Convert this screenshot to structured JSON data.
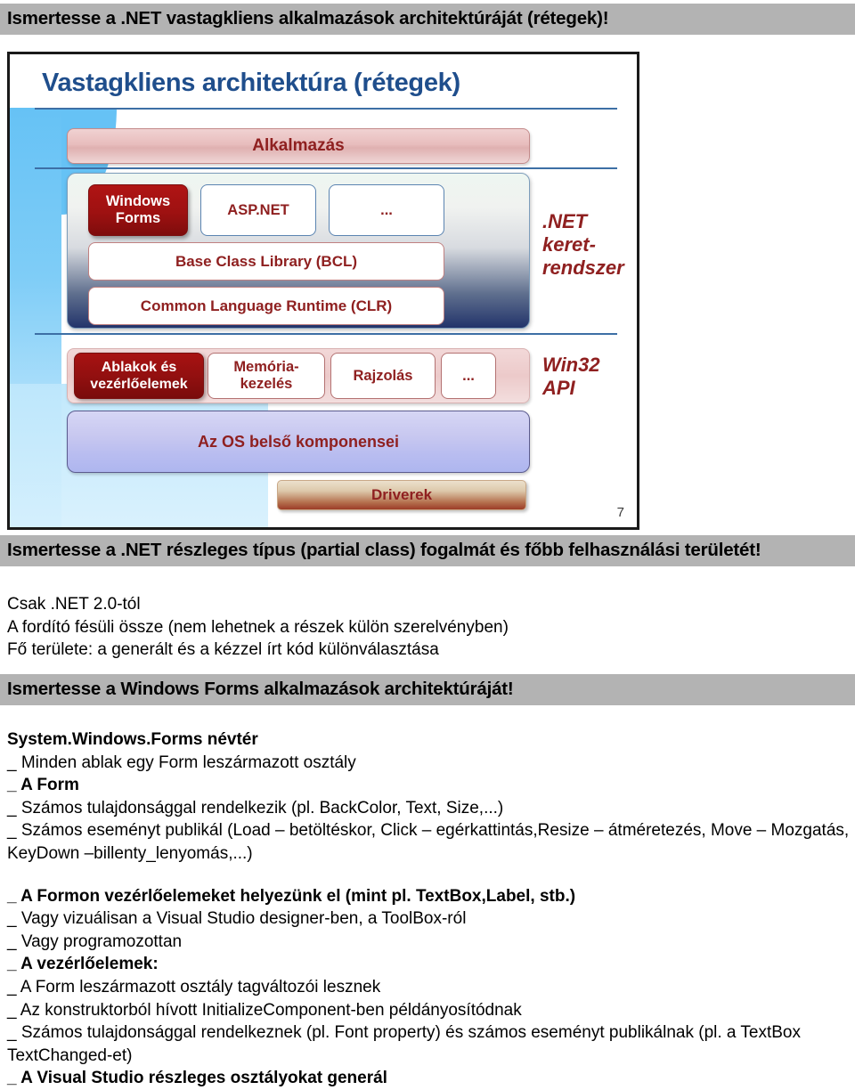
{
  "questions": {
    "q1": "Ismertesse a .NET vastagkliens alkalmazások architektúráját (rétegek)!",
    "q2": "Ismertesse a .NET részleges típus (partial class) fogalmát és főbb felhasználási területét!",
    "q3": "Ismertesse a Windows Forms alkalmazások architektúráját!"
  },
  "slide": {
    "title": "Vastagkliens architektúra (rétegek)",
    "page_number": "7",
    "boxes": {
      "application": "Alkalmazás",
      "windows_forms": "Windows\nForms",
      "asp_net": "ASP.NET",
      "dots_net": "...",
      "bcl": "Base Class Library (BCL)",
      "clr": "Common Language Runtime (CLR)",
      "ablakok": "Ablakok és\nvezérlőelemek",
      "memoria": "Memória-\nkezelés",
      "rajzolas": "Rajzolás",
      "dots_os": "...",
      "os_internals": "Az OS belső komponensei",
      "drivers": "Driverek"
    },
    "side_labels": {
      "net_framework": ".NET\nkeret-\nrendszer",
      "win32": "Win32\nAPI"
    },
    "colors": {
      "title_blue": "#1f4e8c",
      "box_text_red": "#8f2020",
      "highlight_dark_red": "#9e1111",
      "band_blue": "#66c2f5",
      "heading_band_gray": "#b3b3b3"
    }
  },
  "partial_class_section": {
    "lines": [
      {
        "text": "Csak .NET 2.0-tól",
        "bold": false
      },
      {
        "text": "A fordító fésüli össze (nem lehetnek a részek külön szerelvényben)",
        "bold": false
      },
      {
        "text": "Fő területe: a generált és a kézzel írt kód különválasztása",
        "bold": false
      }
    ]
  },
  "winforms_section": {
    "lines": [
      {
        "text": "System.Windows.Forms névtér",
        "bold": true
      },
      {
        "text": "_ Minden ablak egy Form leszármazott osztály",
        "bold": false
      },
      {
        "text": "_ A Form",
        "bold": true
      },
      {
        "text": "_ Számos tulajdonsággal rendelkezik (pl. BackColor, Text, Size,...)",
        "bold": false
      },
      {
        "text": "_ Számos eseményt publikál (Load – betöltéskor, Click – egérkattintás,Resize – átméretezés, Move – Mozgatás, KeyDown –billenty_lenyomás,...)",
        "bold": false
      },
      {
        "text": "",
        "bold": false
      },
      {
        "text": "_ A Formon vezérlőelemeket helyezünk el (mint pl. TextBox,Label, stb.)",
        "bold": true
      },
      {
        "text": "_ Vagy vizuálisan a Visual Studio designer-ben, a ToolBox-ról",
        "bold": false
      },
      {
        "text": "_ Vagy programozottan",
        "bold": false
      },
      {
        "text": "_ A vezérlőelemek:",
        "bold": true
      },
      {
        "text": "_ A Form leszármazott osztály tagváltozói lesznek",
        "bold": false
      },
      {
        "text": "_ Az konstruktorból hívott InitializeComponent-ben példányosítódnak",
        "bold": false
      },
      {
        "text": "_ Számos tulajdonsággal rendelkeznek (pl. Font property) és számos eseményt publikálnak (pl. a TextBox TextChanged-et)",
        "bold": false
      },
      {
        "text": "_ A Visual Studio részleges osztályokat generál",
        "bold": true
      }
    ]
  }
}
